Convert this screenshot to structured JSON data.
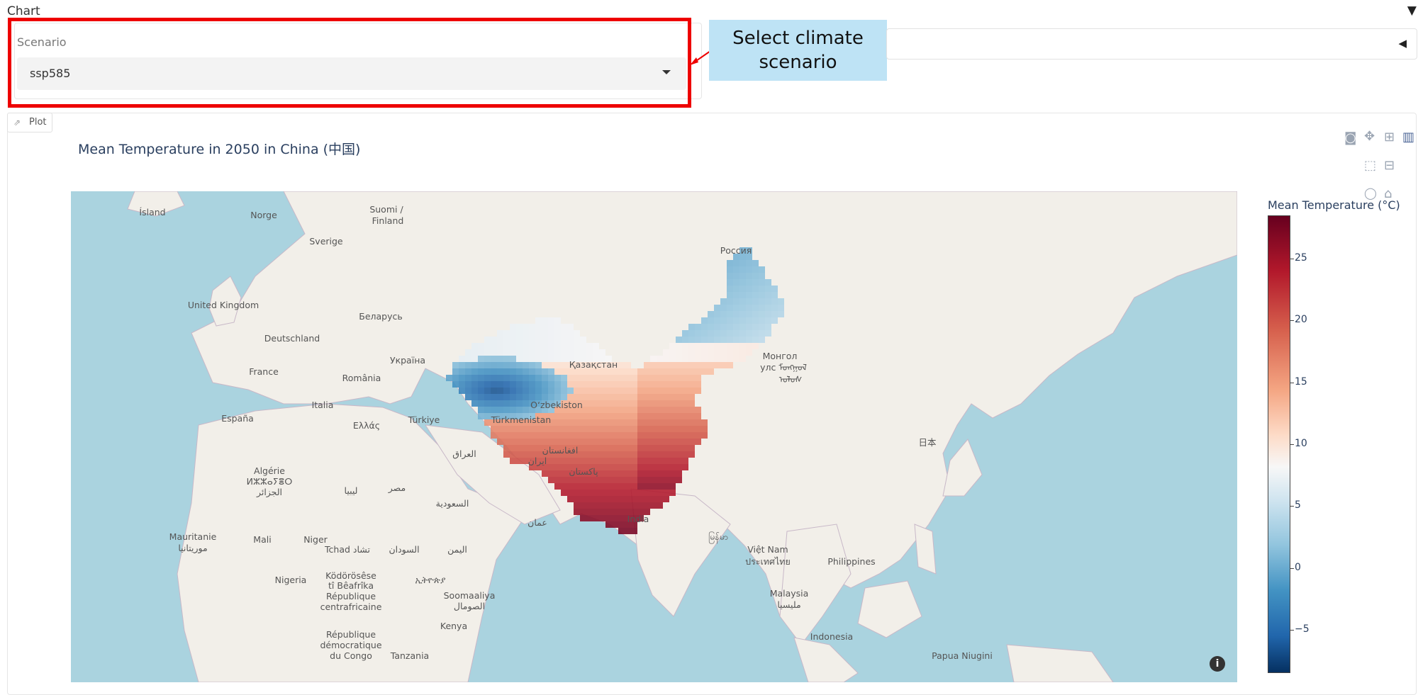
{
  "section": {
    "label": "Chart",
    "toggle_icon": "triangle-down-icon"
  },
  "scenario": {
    "label": "Scenario",
    "selected": "ssp585"
  },
  "callout": {
    "text": "Select climate scenario"
  },
  "plot_tab": {
    "label": "Plot",
    "icon": "chart-icon"
  },
  "chart": {
    "title": "Mean Temperature in 2050 in China (中国)",
    "colorbar_title": "Mean Temperature (°C)"
  },
  "map_labels": [
    "Ísland",
    "Norge",
    "Suomi /",
    "Finland",
    "Sverige",
    "Россия",
    "United Kingdom",
    "Беларусь",
    "Deutschland",
    "Україна",
    "France",
    "Қазақстан",
    "Монгол",
    "улс ᠮᠣᠩᠭᠣᠯ",
    "ᠤᠯᠤᠰ",
    "România",
    "España",
    "Italia",
    "Ελλάς",
    "Türkiye",
    "Türkmenistan",
    "O‘zbekiston",
    "日本",
    "Algérie",
    "ⵍⵣⵣⴰⵢⴻⵔ",
    "الجزائر",
    "العراق",
    "ایران",
    "افغانستان",
    "پاکستان",
    "مصر",
    "ليبيا",
    "السعودية",
    "عمان",
    "India",
    "Mauritanie",
    "موريتانيا",
    "Mali",
    "Niger",
    "Tchad تشاد",
    "السودان",
    "اليمن",
    "မြန်မာ",
    "Việt Nam",
    "ประเทศไทย",
    "Philippines",
    "Nigeria",
    "Ködörösêse",
    "tî Bêafrîka",
    "République",
    "centrafricaine",
    "ኢትዮጵያ",
    "Soomaaliya",
    "الصومال",
    "Kenya",
    "Malaysia",
    "ملیسیا",
    "République",
    "démocratique",
    "du Congo",
    "Tanzania",
    "Indonesia",
    "Papua Niugini"
  ],
  "chart_data": {
    "type": "heatmap",
    "title": "Mean Temperature in 2050 in China (中国)",
    "colorbar": {
      "title": "Mean Temperature (°C)",
      "range": [
        -8.5,
        28.5
      ],
      "ticks": [
        25,
        20,
        15,
        10,
        5,
        0,
        -5
      ],
      "tick_labels": [
        "25",
        "20",
        "15",
        "10",
        "5",
        "0",
        "−5"
      ],
      "colorscale": "RdBu (reversed)"
    }
  }
}
